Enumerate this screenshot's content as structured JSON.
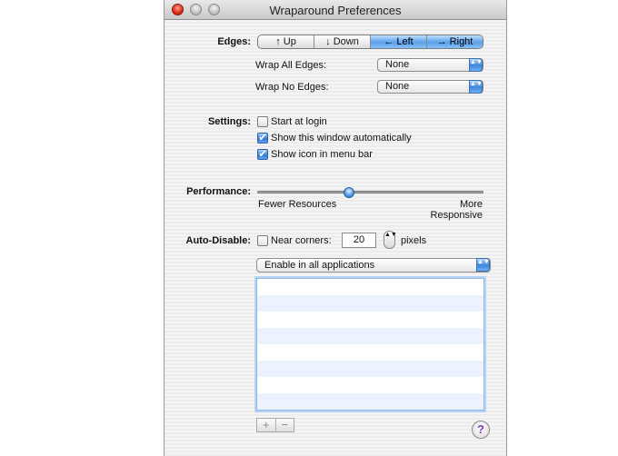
{
  "window": {
    "title": "Wraparound Preferences"
  },
  "edges": {
    "label": "Edges:",
    "segments": [
      {
        "label": "↑ Up",
        "selected": false
      },
      {
        "label": "↓ Down",
        "selected": false
      },
      {
        "label": "← Left",
        "selected": true
      },
      {
        "label": "→ Right",
        "selected": true
      }
    ],
    "wrap_all_label": "Wrap All Edges:",
    "wrap_all_value": "None",
    "wrap_no_label": "Wrap No Edges:",
    "wrap_no_value": "None"
  },
  "settings": {
    "label": "Settings:",
    "start_at_login": {
      "label": "Start at login",
      "checked": false
    },
    "show_window": {
      "label": "Show this window automatically",
      "checked": true
    },
    "show_icon": {
      "label": "Show icon in menu bar",
      "checked": true
    }
  },
  "performance": {
    "label": "Performance:",
    "min_label": "Fewer Resources",
    "max_label": "More Responsive",
    "level": 0.4
  },
  "auto_disable": {
    "label": "Auto-Disable:",
    "near_corners": {
      "label": "Near corners:",
      "checked": false,
      "value": "20",
      "unit": "pixels"
    },
    "mode_value": "Enable in all applications"
  },
  "list_buttons": {
    "add_label": "+",
    "remove_label": "−"
  },
  "help": {
    "label": "?"
  },
  "colors": {
    "accent": "#4a8ee0",
    "help_glyph": "#7a3fb1"
  },
  "icons": {
    "checkmark": "✔",
    "popup_arrows": "▲▼",
    "stepper_arrows": "▲▼"
  }
}
